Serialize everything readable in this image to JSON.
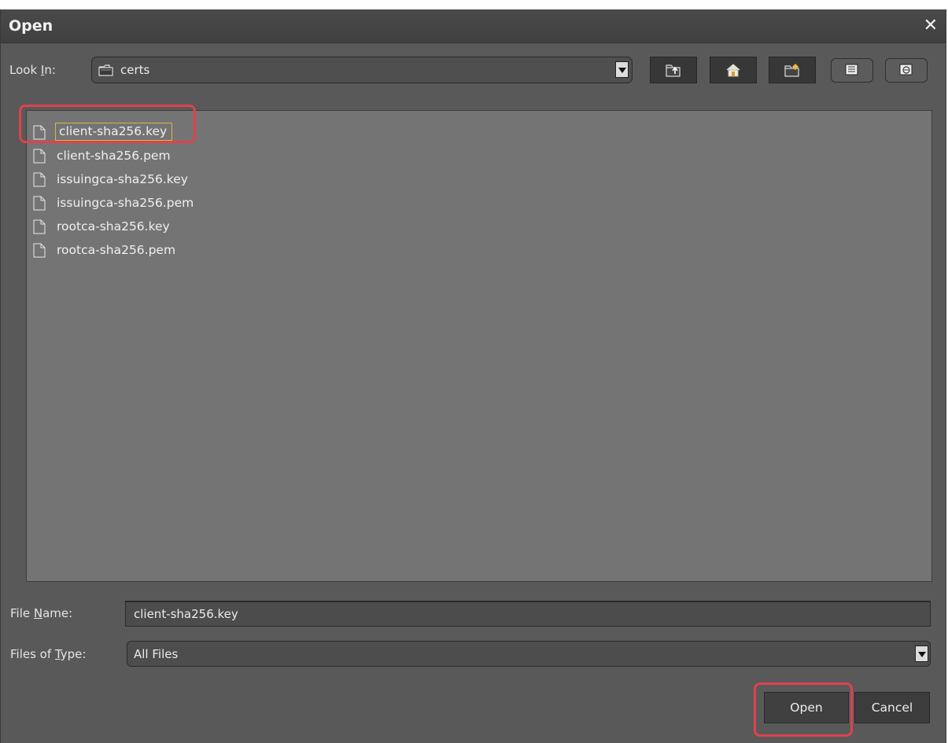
{
  "window": {
    "title": "Open",
    "close_glyph": "✕"
  },
  "look_in": {
    "label_pre": "Look ",
    "label_mnemonic": "I",
    "label_post": "n:",
    "current_folder": "certs",
    "folder_icon": "folder-icon"
  },
  "toolbar": {
    "icons": [
      "up-folder-icon",
      "home-icon",
      "new-folder-icon",
      "list-view-icon",
      "details-view-icon"
    ]
  },
  "files": [
    {
      "name": "client-sha256.key",
      "selected": true
    },
    {
      "name": "client-sha256.pem",
      "selected": false
    },
    {
      "name": "issuingca-sha256.key",
      "selected": false
    },
    {
      "name": "issuingca-sha256.pem",
      "selected": false
    },
    {
      "name": "rootca-sha256.key",
      "selected": false
    },
    {
      "name": "rootca-sha256.pem",
      "selected": false
    }
  ],
  "file_name": {
    "label_pre": "File ",
    "label_mnemonic": "N",
    "label_post": "ame:",
    "value": "client-sha256.key"
  },
  "files_of_type": {
    "label_pre": "Files of ",
    "label_mnemonic": "T",
    "label_post": "ype:",
    "value": "All Files"
  },
  "buttons": {
    "open": "Open",
    "cancel": "Cancel"
  },
  "colors": {
    "highlight": "#e0424a",
    "selection_border": "#d8b44a",
    "dialog_bg": "#595959",
    "list_bg": "#747474"
  }
}
